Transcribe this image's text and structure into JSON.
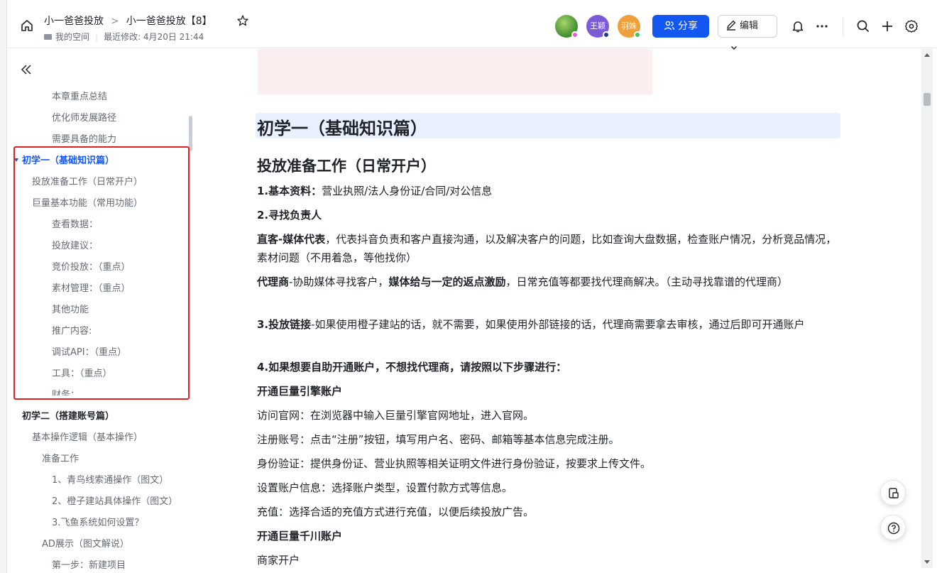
{
  "header": {
    "breadcrumb": [
      "小一爸爸投放",
      "小一爸爸投放【8】"
    ],
    "breadcrumb_sep": ">",
    "space": "我的空间",
    "last_modified": "最近修改: 4月20日 21:44",
    "avatars": [
      {
        "label": "",
        "color": "#3c8d2f",
        "status": "#e65ccf"
      },
      {
        "label": "王颖",
        "color": "#7b5bd6",
        "status": "#1f3a93"
      },
      {
        "label": "羽姝",
        "color": "#f0a03a",
        "status": "#34c759"
      }
    ],
    "share_label": "分享",
    "edit_label": "编辑",
    "accent": "#1456f0"
  },
  "sidebar": {
    "items": [
      {
        "label": "本章重点总结",
        "level": 3,
        "state": "normal"
      },
      {
        "label": "优化师发展路径",
        "level": 3,
        "state": "normal"
      },
      {
        "label": "需要具备的能力",
        "level": 3,
        "state": "normal"
      },
      {
        "label": "初学一（基础知识篇）",
        "level": 1,
        "state": "active"
      },
      {
        "label": "投放准备工作（日常开户）",
        "level": 2,
        "state": "normal"
      },
      {
        "label": "巨量基本功能（常用功能）",
        "level": 2,
        "state": "normal"
      },
      {
        "label": "查看数据：",
        "level": 3,
        "state": "normal"
      },
      {
        "label": "投放建议：",
        "level": 3,
        "state": "normal"
      },
      {
        "label": "竞价投放：（重点）",
        "level": 3,
        "state": "normal"
      },
      {
        "label": "素材管理：（重点）",
        "level": 3,
        "state": "normal"
      },
      {
        "label": "其他功能",
        "level": 3,
        "state": "normal"
      },
      {
        "label": "推广内容:",
        "level": 3,
        "state": "normal"
      },
      {
        "label": "调试API：（重点）",
        "level": 3,
        "state": "normal"
      },
      {
        "label": "工具：（重点）",
        "level": 3,
        "state": "normal"
      },
      {
        "label": "财务：",
        "level": 3,
        "state": "normal"
      },
      {
        "label": "初学二（搭建账号篇）",
        "level": 1,
        "state": "h1"
      },
      {
        "label": "基本操作逻辑（基本操作）",
        "level": 2,
        "state": "normal"
      },
      {
        "label": "准备工作",
        "level": 2.5,
        "state": "normal"
      },
      {
        "label": "1、青鸟线索通操作（图文）",
        "level": 3,
        "state": "normal"
      },
      {
        "label": "2、橙子建站具体操作（图文）",
        "level": 3,
        "state": "normal"
      },
      {
        "label": "3.飞鱼系统如何设置？",
        "level": 3,
        "state": "normal"
      },
      {
        "label": "AD展示（图文解说）",
        "level": 2.5,
        "state": "normal"
      },
      {
        "label": "第一步：新建项目",
        "level": 3,
        "state": "normal"
      }
    ]
  },
  "doc": {
    "h1": "初学一（基础知识篇）",
    "h2": "投放准备工作（日常开户）",
    "p1_bold": "1.基本资料：",
    "p1_text": "营业执照/法人身份证/合同/对公信息",
    "p2": "2.寻找负责人",
    "p3_bold": "直客-媒体代表",
    "p3_text": "，代表抖音负责和客户直接沟通，以及解决客户的问题，比如查询大盘数据，检查账户情况，分析竞品情况，素材问题（不用着急，等他找你）",
    "p4_bold1": "代理商",
    "p4_text1": "-协助媒体寻找客户，",
    "p4_bold2": "媒体给与一定的返点激励",
    "p4_text2": "，日常充值等都要找代理商解决。（主动寻找靠谱的代理商）",
    "p5_bold": "3.投放链接",
    "p5_text": "-如果使用橙子建站的话，就不需要，如果使用外部链接的话，代理商需要拿去审核，通过后即可开通账户",
    "p6": "4.如果想要自助开通账户，不想找代理商，请按照以下步骤进行：",
    "p7": "开通巨量引擎账户",
    "p8": "访问官网：在浏览器中输入巨量引擎官网地址，进入官网。",
    "p9": "注册账号：点击“注册”按钮，填写用户名、密码、邮箱等基本信息完成注册。",
    "p10": "身份验证：提供身份证、营业执照等相关证明文件进行身份验证，按要求上传文件。",
    "p11": "设置账户信息：选择账户类型，设置付款方式等信息。",
    "p12": "充值：选择合适的充值方式进行充值，以便后续投放广告。",
    "p13": "开通巨量千川账户",
    "p14": "商家开户"
  }
}
